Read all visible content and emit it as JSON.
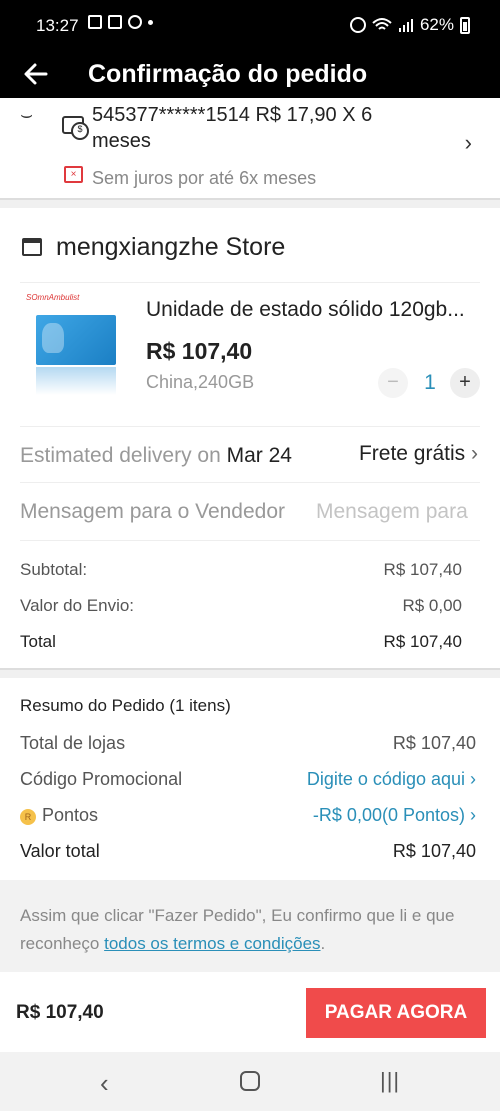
{
  "status_bar": {
    "time": "13:27",
    "battery": "62%"
  },
  "app_bar": {
    "title": "Confirmação do pedido"
  },
  "payment": {
    "card_text": "545377******1514  R$ 17,90 X 6 meses",
    "no_interest": "Sem juros por até 6x meses"
  },
  "store": {
    "name": "mengxiangzhe Store",
    "product": {
      "logo_text": "SOmnAmbulist",
      "title": "Unidade de estado sólido 120gb...",
      "price": "R$ 107,40",
      "variant": "China,240GB",
      "qty_minus": "−",
      "quantity": "1",
      "qty_plus": "+"
    },
    "delivery_label": "Estimated delivery on ",
    "delivery_date": "Mar 24",
    "shipping": "Frete grátis",
    "message_label": "Mensagem para o Vendedor",
    "message_placeholder": "Mensagem para",
    "subtotal_label": "Subtotal:",
    "subtotal_value": "R$ 107,40",
    "shipping_cost_label": "Valor do Envio:",
    "shipping_cost_value": "R$ 0,00",
    "total_label": "Total",
    "total_value": "R$ 107,40"
  },
  "summary": {
    "heading": "Resumo do Pedido (1 itens)",
    "stores_total_label": "Total de lojas",
    "stores_total_value": "R$ 107,40",
    "promo_label": "Código Promocional",
    "promo_link": "Digite o código aqui",
    "points_label": "Pontos",
    "points_value": "-R$ 0,00(0 Pontos)",
    "final_label": "Valor total",
    "final_value": "R$ 107,40"
  },
  "terms": {
    "text": "Assim que clicar \"Fazer Pedido\", Eu confirmo que li e que reconheço ",
    "link": "todos os termos e condições",
    "suffix": "."
  },
  "bottom": {
    "amount": "R$ 107,40",
    "pay_button": "PAGAR AGORA"
  },
  "colors": {
    "accent": "#2a8fb8",
    "pay_button": "#f04b4b",
    "header": "#000000"
  }
}
